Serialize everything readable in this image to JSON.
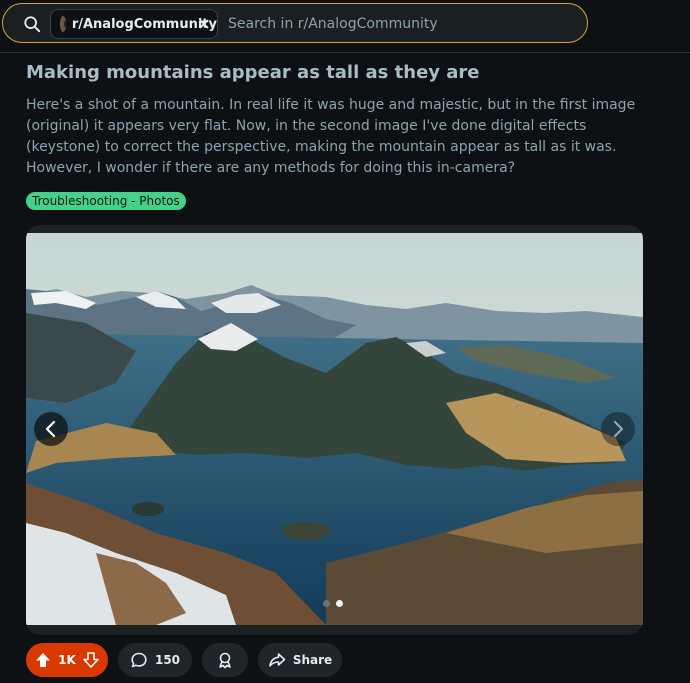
{
  "search": {
    "community_chip": "r/AnalogCommunity",
    "placeholder": "Search in r/AnalogCommunity"
  },
  "post": {
    "title": "Making mountains appear as tall as they are",
    "body": "Here's a shot of a mountain. In real life it was huge and majestic, but in the first image (original) it appears very flat. Now, in the second image I've done digital effects (keystone) to correct the perspective, making the mountain appear as tall as it was. However, I wonder if there are any methods for doing this in-camera?",
    "flair": "Troubleshooting - Photos"
  },
  "gallery": {
    "image_count": 2,
    "current_index": 2
  },
  "actions": {
    "vote_count": "1K",
    "comment_count": "150",
    "share_label": "Share"
  },
  "colors": {
    "accent_upvote": "#d93900",
    "flair_bg": "#46d18b",
    "search_border": "#d9a233"
  }
}
